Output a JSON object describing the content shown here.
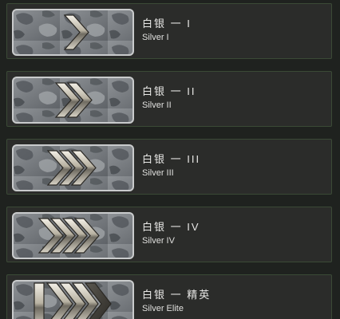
{
  "ranks": [
    {
      "title": "白银 一 I",
      "subtitle": "Silver I"
    },
    {
      "title": "白银 一 II",
      "subtitle": "Silver II"
    },
    {
      "title": "白银 一 III",
      "subtitle": "Silver III"
    },
    {
      "title": "白银 一 IV",
      "subtitle": "Silver IV"
    },
    {
      "title": "白银 一 精英",
      "subtitle": "Silver Elite"
    }
  ]
}
